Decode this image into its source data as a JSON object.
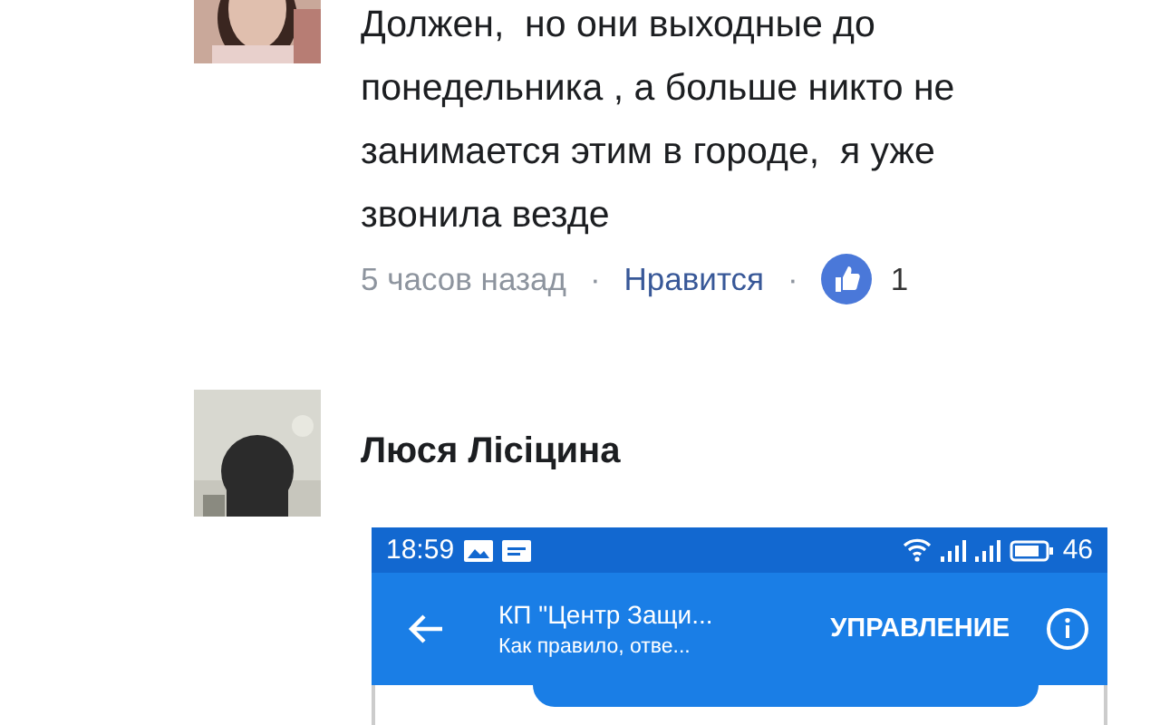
{
  "comments": [
    {
      "lines": [
        "Должен,  но они выходные до",
        "понедельника , а больше никто не",
        "занимается этим в городе,  я уже",
        "звонила везде"
      ],
      "time": "5 часов назад",
      "separator_1": "·",
      "like_action": "Нравится",
      "separator_2": "·",
      "like_count": "1"
    },
    {
      "author": "Люся Лісіцина",
      "attachment": {
        "status_bar": {
          "time": "18:59",
          "battery_level": "46"
        },
        "app_bar": {
          "title": "КП \"Центр Защи...",
          "subtitle": "Как правило, отве...",
          "action": "УПРАВЛЕНИЕ"
        }
      }
    }
  ]
}
